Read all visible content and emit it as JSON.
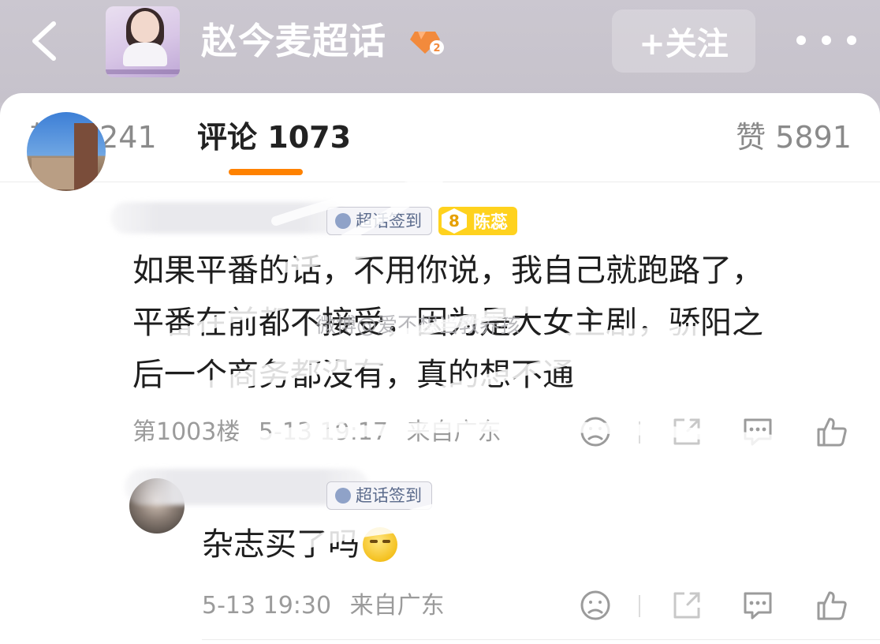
{
  "header": {
    "group_title": "赵今麦超话",
    "follow_label": "+关注",
    "icons": [
      "back-chevron-icon",
      "super-topic-level-icon",
      "more-dots-icon"
    ]
  },
  "tabs": {
    "repost_label": "转发",
    "repost_count": "241",
    "comments_label": "评论",
    "comments_count": "1073",
    "likes_label": "赞",
    "likes_count": "5891",
    "active_indicator_color": "#ff8200"
  },
  "comment": {
    "checkin_badge": "超话签到",
    "fan_badge_level": "8",
    "fan_badge_name": "陈蕊",
    "fan_badge_color": "#ffd21e",
    "lines": [
      "如果平番的话，不用你说，我自己就跑路了，",
      "平番在前都不接受，因为是大女主剧，骄阳之",
      "后一个商务都没有，真的想不通"
    ],
    "floor": "第1003楼",
    "time": "5-13 19:17",
    "location": "来自广东",
    "action_icons": [
      "dislike-icon",
      "share-icon",
      "reply-icon",
      "like-icon"
    ]
  },
  "reply": {
    "checkin_badge": "超话签到",
    "text": "杂志买了吗",
    "emoji": "thinking-emoji-icon",
    "time": "5-13 19:30",
    "location": "来自广东",
    "action_icons": [
      "dislike-icon",
      "share-icon",
      "reply-icon",
      "like-icon"
    ]
  },
  "watermark": "微博@爱不想当教养孩"
}
